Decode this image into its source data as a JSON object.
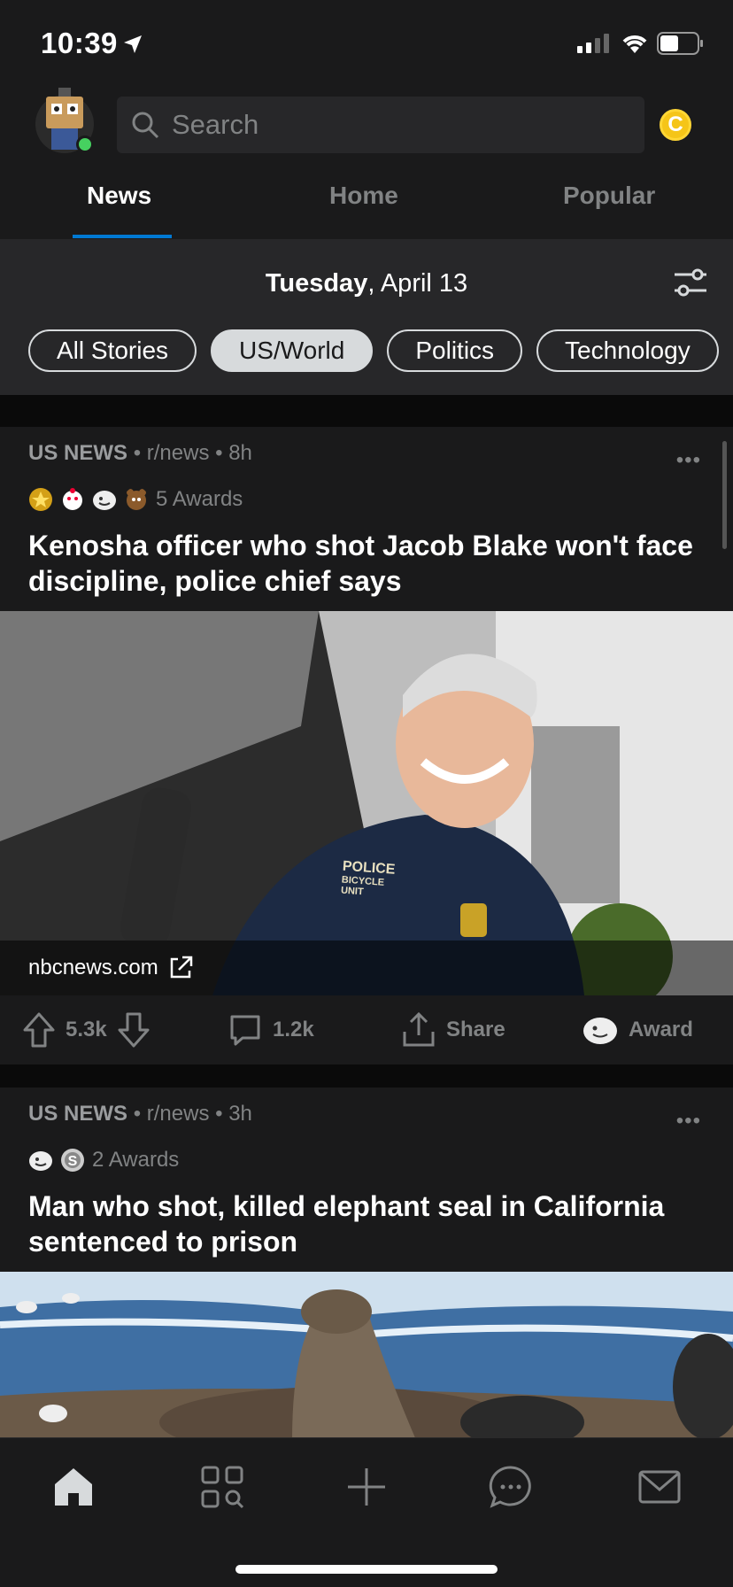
{
  "status_bar": {
    "time": "10:39"
  },
  "header": {
    "search_placeholder": "Search",
    "coin_label": "C",
    "tabs": [
      {
        "label": "News",
        "active": true
      },
      {
        "label": "Home",
        "active": false
      },
      {
        "label": "Popular",
        "active": false
      }
    ]
  },
  "date_bar": {
    "day": "Tuesday",
    "date": ", April 13"
  },
  "chips": [
    {
      "label": "All Stories",
      "selected": false
    },
    {
      "label": "US/World",
      "selected": true
    },
    {
      "label": "Politics",
      "selected": false
    },
    {
      "label": "Technology",
      "selected": false
    }
  ],
  "posts": [
    {
      "category": "US NEWS",
      "subreddit": "r/news",
      "age": "8h",
      "awards_label": "5 Awards",
      "title": "Kenosha officer who shot Jacob Blake won't face discipline, police chief says",
      "link_domain": "nbcnews.com",
      "image_text_1": "POLICE",
      "image_text_2": "BICYCLE UNIT",
      "votes": "5.3k",
      "comments": "1.2k",
      "share_label": "Share",
      "award_label": "Award"
    },
    {
      "category": "US NEWS",
      "subreddit": "r/news",
      "age": "3h",
      "awards_label": "2 Awards",
      "title": "Man who shot, killed elephant seal in California sentenced to prison"
    }
  ],
  "separators": {
    "dot": "•",
    "more": "•••"
  },
  "colors": {
    "background": "#1a1a1b",
    "accent": "#0079d3",
    "online": "#46d160",
    "coin": "#f5c518"
  },
  "bottom_nav_icons": [
    "home-icon",
    "discover-icon",
    "create-post-icon",
    "chat-icon",
    "inbox-icon"
  ]
}
